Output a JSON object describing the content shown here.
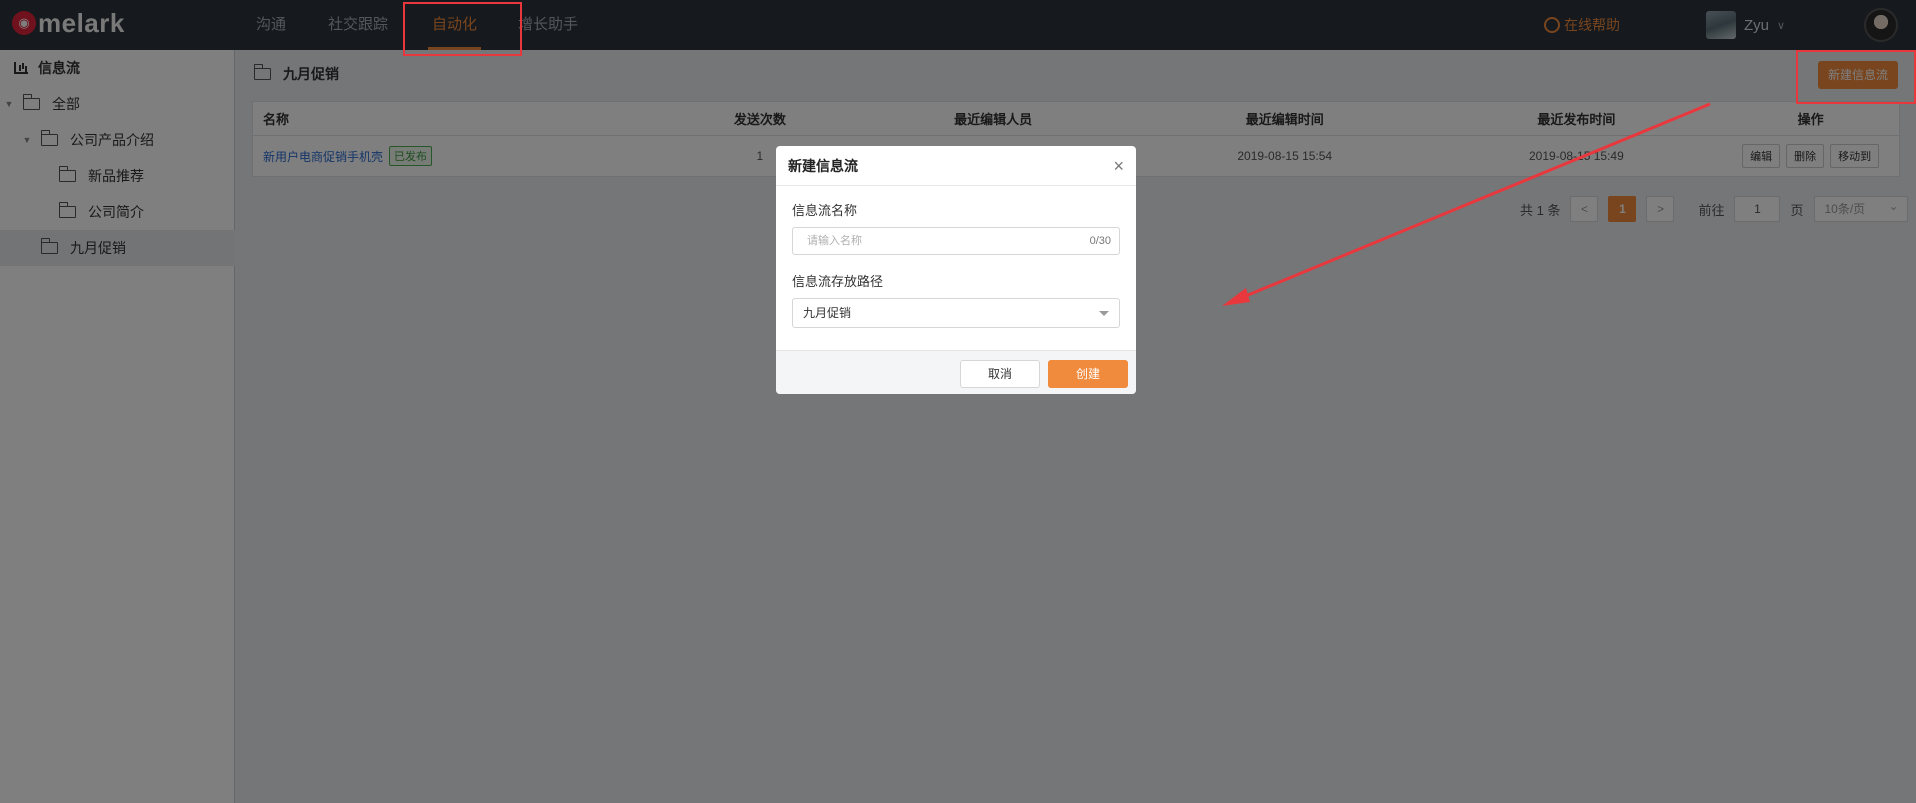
{
  "brand": {
    "logo_text": "melark"
  },
  "topnav": {
    "items": [
      {
        "label": "沟通"
      },
      {
        "label": "社交跟踪"
      },
      {
        "label": "自动化"
      },
      {
        "label": "增长助手"
      }
    ],
    "active_index": 2,
    "help_label": "在线帮助",
    "user_name": "Zyu"
  },
  "sidebar": {
    "title": "信息流",
    "tree": [
      {
        "label": "全部"
      },
      {
        "label": "公司产品介绍"
      },
      {
        "label": "新品推荐"
      },
      {
        "label": "公司简介"
      },
      {
        "label": "九月促销"
      }
    ]
  },
  "main": {
    "breadcrumb": "九月促销",
    "new_button_label": "新建信息流"
  },
  "table": {
    "headers": [
      "名称",
      "发送次数",
      "最近编辑人员",
      "最近编辑时间",
      "最近发布时间",
      "操作"
    ],
    "rows": [
      {
        "name": "新用户电商促销手机壳",
        "status": "已发布",
        "send_count": "1",
        "editor": "",
        "edited_at": "2019-08-15 15:54",
        "published_at": "2019-08-15 15:49",
        "actions": [
          "编辑",
          "删除",
          "移动到"
        ]
      }
    ]
  },
  "pagination": {
    "total_text": "共 1 条",
    "prev": "<",
    "current_page": "1",
    "next": ">",
    "goto_label": "前往",
    "goto_value": "1",
    "page_unit": "页",
    "page_size": "10条/页"
  },
  "dialog": {
    "title": "新建信息流",
    "close_icon": "×",
    "name_label": "信息流名称",
    "name_placeholder": "请输入名称",
    "name_counter": "0/30",
    "path_label": "信息流存放路径",
    "path_value": "九月促销",
    "cancel_label": "取消",
    "create_label": "创建"
  },
  "colors": {
    "accent": "#f08a3c",
    "topbar": "#2c323a",
    "annotation": "#e8383d",
    "link": "#2a6bd1",
    "published": "#3c9a3f"
  }
}
